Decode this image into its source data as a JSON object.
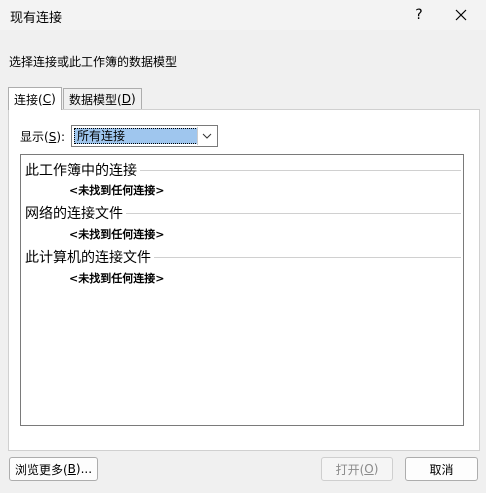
{
  "window": {
    "title": "现有连接",
    "help_label": "?"
  },
  "instruction": "选择连接或此工作簿的数据模型",
  "tabs": [
    {
      "label_pre": "连接(",
      "accel": "C",
      "label_post": ")"
    },
    {
      "label_pre": "数据模型(",
      "accel": "D",
      "label_post": ")"
    }
  ],
  "show": {
    "label_pre": "显示(",
    "accel": "S",
    "label_post": "):",
    "selected": "所有连接"
  },
  "groups": [
    {
      "header": "此工作簿中的连接",
      "empty": "<未找到任何连接>"
    },
    {
      "header": "网络的连接文件",
      "empty": "<未找到任何连接>"
    },
    {
      "header": "此计算机的连接文件",
      "empty": "<未找到任何连接>"
    }
  ],
  "buttons": {
    "browse_pre": "浏览更多(",
    "browse_accel": "B",
    "browse_post": ")...",
    "open_pre": "打开(",
    "open_accel": "O",
    "open_post": ")",
    "cancel": "取消"
  }
}
